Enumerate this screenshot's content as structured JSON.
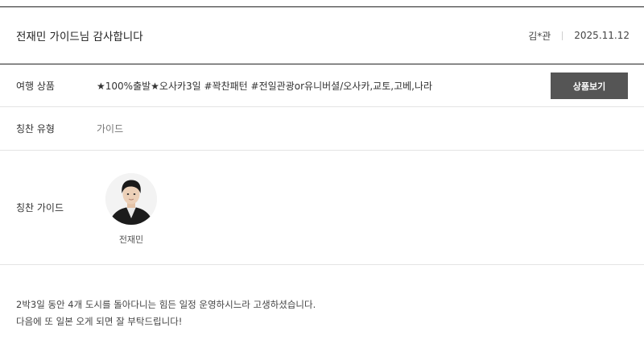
{
  "review": {
    "title": "전재민 가이드님 감사합니다",
    "author": "김*관",
    "date": "2025.11.12"
  },
  "product_row": {
    "label": "여행 상품",
    "value": "★100%출발★오사카3일 #꽉찬패턴 #전일관광or유니버셜/오사카,교토,고베,나라",
    "button_label": "상품보기"
  },
  "type_row": {
    "label": "칭찬 유형",
    "value": "가이드"
  },
  "guide_row": {
    "label": "칭찬 가이드",
    "guide_name": "전재민"
  },
  "message": {
    "line1": "2박3일 동안 4개 도시를 돌아다니는 힘든 일정 운영하시느라 고생하셨습니다.",
    "line2": "다음에 또 일본 오게 되면 잘 부탁드립니다!"
  }
}
